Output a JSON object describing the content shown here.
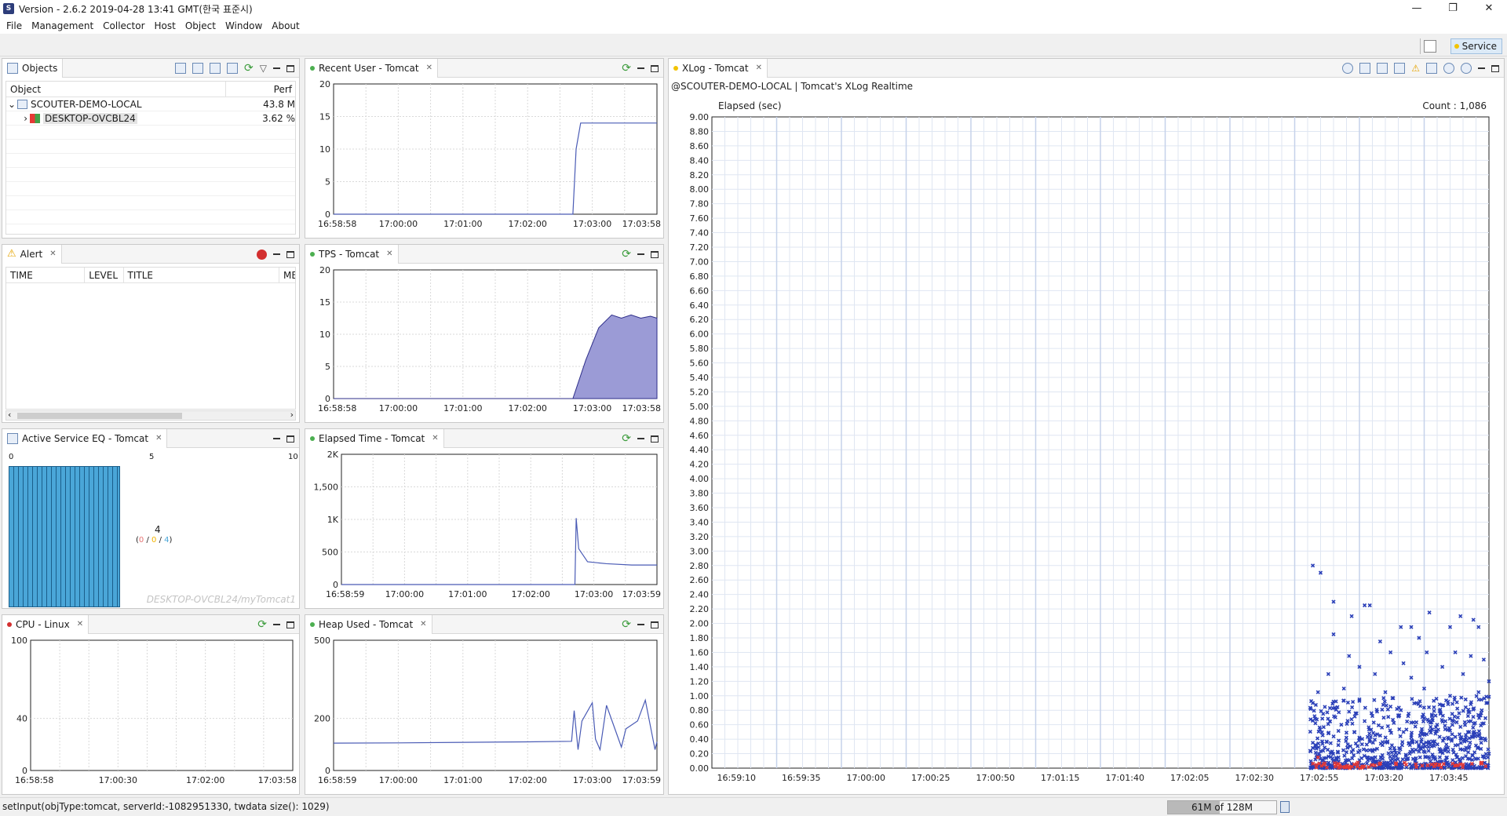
{
  "window": {
    "title": "Version - 2.6.2 2019-04-28 13:41 GMT(한국 표준시)",
    "controls": {
      "minimize": "—",
      "restore": "❐",
      "close": "✕"
    }
  },
  "menu": [
    "File",
    "Management",
    "Collector",
    "Host",
    "Object",
    "Window",
    "About"
  ],
  "toolbar": {
    "perspective_label": "Service"
  },
  "objects_panel": {
    "tab": "Objects",
    "columns": [
      "Object",
      "Perf"
    ],
    "rows": [
      {
        "toggle": "⌄",
        "name": "SCOUTER-DEMO-LOCAL",
        "perf": "43.8 M"
      },
      {
        "toggle": "›",
        "name": "DESKTOP-OVCBL24",
        "perf": "3.62 %"
      }
    ]
  },
  "alert_panel": {
    "tab": "Alert",
    "columns": [
      "TIME",
      "LEVEL",
      "TITLE",
      "ME"
    ]
  },
  "active_service": {
    "tab": "Active Service EQ - Tomcat",
    "scale": [
      "0",
      "5",
      "10"
    ],
    "count": "4",
    "breakdown": {
      "open": "(",
      "a": "0",
      "s1": " / ",
      "b": "0",
      "s2": " / ",
      "c": "4",
      "close": ")"
    },
    "watermark": "DESKTOP-OVCBL24/myTomcat1",
    "bar_fraction": 0.4
  },
  "cpu_panel": {
    "tab": "CPU - Linux",
    "chart_data": {
      "type": "line",
      "x_ticks": [
        "16:58:58",
        "17:00:30",
        "17:02:00",
        "17:03:58"
      ],
      "y_ticks": [
        "100",
        "40",
        "0"
      ],
      "series": []
    }
  },
  "recent_user": {
    "tab": "Recent User - Tomcat",
    "chart_data": {
      "type": "line",
      "ylim": [
        0,
        20
      ],
      "y_ticks": [
        "20",
        "15",
        "10",
        "5",
        "0"
      ],
      "x_ticks": [
        "16:58:58",
        "17:00:00",
        "17:01:00",
        "17:02:00",
        "17:03:00",
        "17:03:58"
      ],
      "x": [
        0,
        3.7,
        3.75,
        3.82,
        3.9,
        5
      ],
      "values": [
        0,
        0,
        10,
        14,
        14,
        14
      ]
    }
  },
  "tps": {
    "tab": "TPS - Tomcat",
    "chart_data": {
      "type": "area",
      "ylim": [
        0,
        20
      ],
      "y_ticks": [
        "20",
        "15",
        "10",
        "5",
        "0"
      ],
      "x_ticks": [
        "16:58:58",
        "17:00:00",
        "17:01:00",
        "17:02:00",
        "17:03:00",
        "17:03:58"
      ],
      "x": [
        0,
        3.7,
        3.9,
        4.1,
        4.3,
        4.45,
        4.6,
        4.75,
        4.9,
        5
      ],
      "values": [
        0,
        0,
        6,
        11,
        13,
        12.5,
        13,
        12.5,
        12.8,
        12.5
      ]
    }
  },
  "elapsed_time": {
    "tab": "Elapsed Time - Tomcat",
    "chart_data": {
      "type": "line",
      "ylim": [
        0,
        2000
      ],
      "y_ticks": [
        "2K",
        "1,500",
        "1K",
        "500",
        "0"
      ],
      "x_ticks": [
        "16:58:59",
        "17:00:00",
        "17:01:00",
        "17:02:00",
        "17:03:00",
        "17:03:59"
      ],
      "x": [
        0,
        3.7,
        3.72,
        3.76,
        3.9,
        4.2,
        4.6,
        5
      ],
      "values": [
        0,
        0,
        1020,
        550,
        350,
        320,
        300,
        300
      ]
    }
  },
  "heap_used": {
    "tab": "Heap Used - Tomcat",
    "chart_data": {
      "type": "line",
      "ylim": [
        0,
        500
      ],
      "y_ticks": [
        "500",
        "200",
        "0"
      ],
      "x_ticks": [
        "16:58:59",
        "17:00:00",
        "17:01:00",
        "17:02:00",
        "17:03:00",
        "17:03:59"
      ],
      "x": [
        0,
        1,
        2,
        3,
        3.68,
        3.72,
        3.78,
        3.84,
        4.0,
        4.05,
        4.12,
        4.22,
        4.45,
        4.52,
        4.7,
        4.82,
        4.97,
        5
      ],
      "values": [
        105,
        106,
        108,
        110,
        112,
        230,
        80,
        190,
        260,
        120,
        80,
        250,
        90,
        160,
        190,
        270,
        80,
        110
      ]
    }
  },
  "xlog": {
    "tab": "XLog - Tomcat",
    "subtitle": "@SCOUTER-DEMO-LOCAL | Tomcat's XLog Realtime",
    "ylabel": "Elapsed (sec)",
    "count_label": "Count : 1,086",
    "chart_data": {
      "type": "scatter",
      "ylim": [
        0,
        9
      ],
      "y_ticks": [
        "9.00",
        "8.80",
        "8.60",
        "8.40",
        "8.20",
        "8.00",
        "7.80",
        "7.60",
        "7.40",
        "7.20",
        "7.00",
        "6.80",
        "6.60",
        "6.40",
        "6.20",
        "6.00",
        "5.80",
        "5.60",
        "5.40",
        "5.20",
        "5.00",
        "4.80",
        "4.60",
        "4.40",
        "4.20",
        "4.00",
        "3.80",
        "3.60",
        "3.40",
        "3.20",
        "3.00",
        "2.80",
        "2.60",
        "2.40",
        "2.20",
        "2.00",
        "1.80",
        "1.60",
        "1.40",
        "1.20",
        "1.00",
        "0.80",
        "0.60",
        "0.40",
        "0.20",
        "0.00"
      ],
      "x_ticks": [
        "16:59:10",
        "16:59:35",
        "17:00:00",
        "17:00:25",
        "17:00:50",
        "17:01:15",
        "17:01:40",
        "17:02:05",
        "17:02:30",
        "17:02:55",
        "17:03:20",
        "17:03:45"
      ],
      "xrange": [
        0,
        300
      ],
      "point_count": 1086,
      "xmin_active": 231,
      "points": [
        [
          232,
          2.8
        ],
        [
          235,
          2.7
        ],
        [
          240,
          2.3
        ],
        [
          252,
          2.25
        ],
        [
          254,
          2.25
        ],
        [
          247,
          2.1
        ],
        [
          277,
          2.15
        ],
        [
          289,
          2.1
        ],
        [
          294,
          2.05
        ],
        [
          285,
          1.95
        ],
        [
          266,
          1.95
        ],
        [
          270,
          1.95
        ],
        [
          240,
          1.85
        ],
        [
          296,
          1.95
        ],
        [
          258,
          1.75
        ],
        [
          273,
          1.8
        ],
        [
          246,
          1.55
        ],
        [
          262,
          1.6
        ],
        [
          276,
          1.6
        ],
        [
          287,
          1.6
        ],
        [
          293,
          1.55
        ],
        [
          250,
          1.4
        ],
        [
          267,
          1.45
        ],
        [
          282,
          1.4
        ],
        [
          298,
          1.5
        ],
        [
          238,
          1.3
        ],
        [
          256,
          1.3
        ],
        [
          270,
          1.25
        ],
        [
          290,
          1.3
        ],
        [
          300,
          1.2
        ],
        [
          234,
          1.05
        ],
        [
          244,
          1.1
        ],
        [
          260,
          1.05
        ],
        [
          275,
          1.1
        ],
        [
          285,
          1.0
        ],
        [
          296,
          1.05
        ],
        [
          232,
          0.9
        ],
        [
          240,
          0.92
        ],
        [
          250,
          0.95
        ],
        [
          262,
          0.85
        ],
        [
          272,
          0.9
        ],
        [
          281,
          0.88
        ],
        [
          291,
          0.95
        ],
        [
          299,
          0.9
        ],
        [
          236,
          0.75
        ],
        [
          246,
          0.78
        ],
        [
          255,
          0.72
        ],
        [
          266,
          0.8
        ],
        [
          278,
          0.74
        ],
        [
          288,
          0.7
        ],
        [
          297,
          0.76
        ],
        [
          233,
          0.62
        ],
        [
          243,
          0.6
        ],
        [
          252,
          0.65
        ],
        [
          261,
          0.58
        ],
        [
          270,
          0.63
        ],
        [
          280,
          0.6
        ],
        [
          289,
          0.57
        ],
        [
          298,
          0.62
        ],
        [
          238,
          0.48
        ],
        [
          248,
          0.5
        ],
        [
          258,
          0.45
        ],
        [
          267,
          0.5
        ],
        [
          276,
          0.47
        ],
        [
          285,
          0.52
        ],
        [
          294,
          0.46
        ],
        [
          232,
          0.35
        ],
        [
          242,
          0.38
        ],
        [
          251,
          0.33
        ],
        [
          260,
          0.36
        ],
        [
          269,
          0.34
        ],
        [
          279,
          0.37
        ],
        [
          288,
          0.32
        ],
        [
          297,
          0.35
        ],
        [
          236,
          0.24
        ],
        [
          245,
          0.22
        ],
        [
          255,
          0.25
        ],
        [
          264,
          0.21
        ],
        [
          273,
          0.23
        ],
        [
          283,
          0.24
        ],
        [
          292,
          0.22
        ],
        [
          300,
          0.2
        ],
        [
          233,
          0.12
        ],
        [
          241,
          0.14
        ],
        [
          250,
          0.11
        ],
        [
          259,
          0.13
        ],
        [
          268,
          0.12
        ],
        [
          277,
          0.14
        ],
        [
          286,
          0.11
        ],
        [
          295,
          0.13
        ],
        [
          238,
          0.05
        ],
        [
          247,
          0.06
        ],
        [
          256,
          0.04
        ],
        [
          265,
          0.06
        ],
        [
          274,
          0.05
        ],
        [
          284,
          0.04
        ],
        [
          293,
          0.05
        ]
      ],
      "error_points": [
        [
          234,
          0.15
        ],
        [
          241,
          0.05
        ],
        [
          249,
          0.06
        ],
        [
          256,
          0.04
        ],
        [
          268,
          0.05
        ],
        [
          281,
          0.04
        ],
        [
          290,
          0.05
        ],
        [
          297,
          0.06
        ]
      ]
    }
  },
  "status": {
    "message": "setInput(objType:tomcat, serverId:-1082951330, twdata size(): 1029)",
    "heap_label": "61M of 128M",
    "heap_fraction": 0.477
  },
  "colors": {
    "series_line": "#4a5bb5",
    "area_fill": "#9b9bd6",
    "area_stroke": "#2e2e8a",
    "grid": "#d9d9d9",
    "xlog_grid": "#dfe6f2",
    "xlog_band": "#c6d2ea",
    "xlog_point": "#2a3fb8",
    "xlog_error": "#e53935",
    "eq_bar": "#4aa6d8"
  }
}
